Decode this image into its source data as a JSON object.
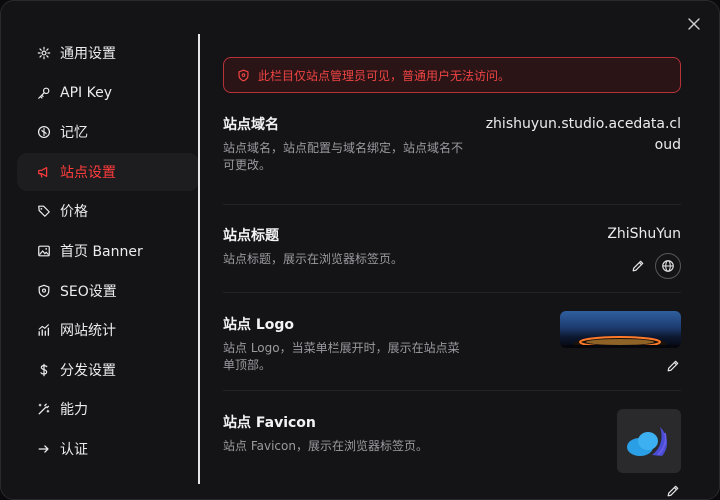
{
  "sidebar": {
    "items": [
      {
        "label": "通用设置",
        "icon": "gear-icon"
      },
      {
        "label": "API Key",
        "icon": "key-icon"
      },
      {
        "label": "记忆",
        "icon": "memory-icon"
      },
      {
        "label": "站点设置",
        "icon": "megaphone-icon",
        "active": true
      },
      {
        "label": "价格",
        "icon": "tag-icon"
      },
      {
        "label": "首页 Banner",
        "icon": "image-icon"
      },
      {
        "label": "SEO设置",
        "icon": "shield-icon"
      },
      {
        "label": "网站统计",
        "icon": "stats-icon"
      },
      {
        "label": "分发设置",
        "icon": "dollar-icon"
      },
      {
        "label": "能力",
        "icon": "magic-wand-icon"
      },
      {
        "label": "认证",
        "icon": "arrow-right-icon"
      }
    ]
  },
  "alert": {
    "text": "此栏目仅站点管理员可见，普通用户无法访问。"
  },
  "settings": {
    "domain": {
      "title": "站点域名",
      "desc": "站点域名，站点配置与域名绑定，站点域名不可更改。",
      "value": "zhishuyun.studio.acedata.cloud"
    },
    "site_title": {
      "title": "站点标题",
      "desc": "站点标题，展示在浏览器标签页。",
      "value": "ZhiShuYun"
    },
    "logo": {
      "title": "站点 Logo",
      "desc": "站点 Logo，当菜单栏展开时，展示在站点菜单顶部。"
    },
    "favicon": {
      "title": "站点 Favicon",
      "desc": "站点 Favicon，展示在浏览器标签页。"
    }
  },
  "colors": {
    "accent": "#ff3b3b",
    "alert_border": "#b8323a"
  }
}
